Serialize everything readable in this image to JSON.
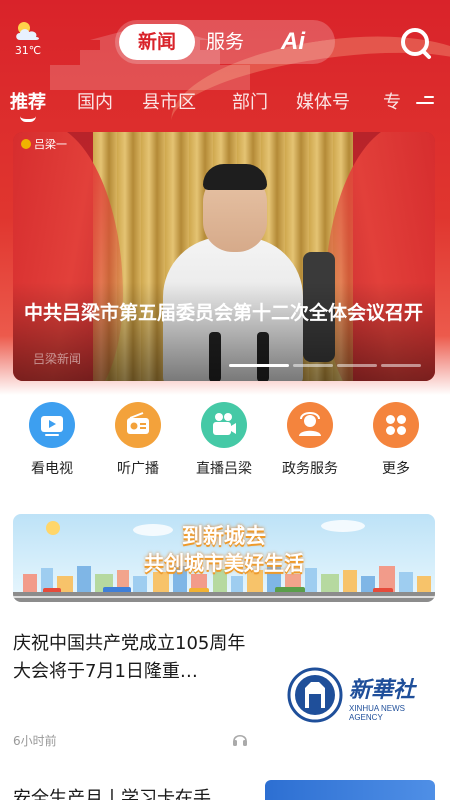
{
  "weather": {
    "icon": "cloud-icon",
    "temp": "31℃"
  },
  "top_tabs": [
    {
      "label": "新闻",
      "active": true
    },
    {
      "label": "服务",
      "active": false
    },
    {
      "label": "Ai",
      "active": false
    }
  ],
  "channels": [
    "推荐",
    "国内",
    "县市区",
    "部门",
    "媒体号",
    "专"
  ],
  "active_channel": "推荐",
  "banner": {
    "title": "中共吕梁市第五届委员会第十二次全体会议召开",
    "logo": "吕梁一",
    "watermark": "吕梁新闻",
    "slide_count": 4,
    "active_slide": 1
  },
  "quick_entries": [
    {
      "label": "看电视",
      "icon": "tv-icon",
      "color": "#3d9ff0"
    },
    {
      "label": "听广播",
      "icon": "radio-icon",
      "color": "#f3a23b"
    },
    {
      "label": "直播吕梁",
      "icon": "video-camera-icon",
      "color": "#45c9a6"
    },
    {
      "label": "政务服务",
      "icon": "government-service-icon",
      "color": "#f4843d"
    },
    {
      "label": "更多",
      "icon": "more-grid-icon",
      "color": "#f4843d"
    }
  ],
  "promo": {
    "line1": "到新城去",
    "line2": "共创城市美好生活"
  },
  "news": [
    {
      "title": "庆祝中国共产党成立105周年大会将于7月1日隆重…",
      "time": "6小时前",
      "thumb_text": "新華社",
      "thumb_sub": "XINHUA NEWS AGENCY"
    },
    {
      "title": "安全生产月丨学习卡在手"
    }
  ],
  "colors": {
    "brand_red": "#d9232a",
    "text": "#1a1a1a",
    "muted": "#999999"
  }
}
